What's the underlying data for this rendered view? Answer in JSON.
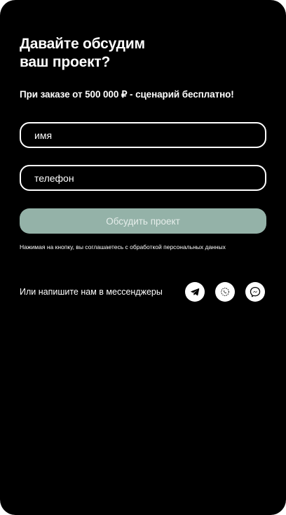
{
  "form": {
    "title_line1": "Давайте обсудим",
    "title_line2": "ваш проект?",
    "subtitle": "При заказе от 500 000 ₽ - сценарий бесплатно!",
    "name_placeholder": "имя",
    "phone_placeholder": "телефон",
    "submit_label": "Обсудить проект",
    "consent_text": "Нажимая на кнопку, вы соглашаетесь с обработкой персональных данных",
    "submit_color": "#94b2a8"
  },
  "messengers": {
    "label": "Или напишите нам в мессенджеры",
    "icons": [
      "telegram-icon",
      "whatsapp-icon",
      "messenger-icon"
    ]
  }
}
